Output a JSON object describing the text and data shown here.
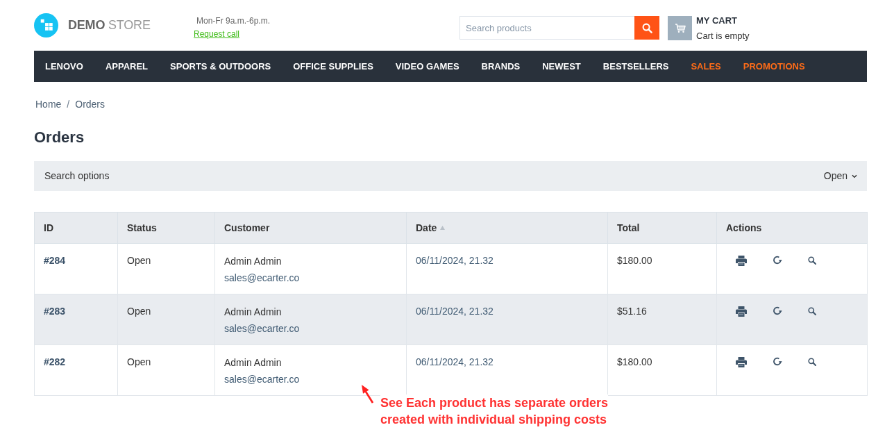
{
  "header": {
    "logo_text": "**DEMO** STORE",
    "hours": "Mon-Fr 9a.m.-6p.m.",
    "request_call": "Request call",
    "search": {
      "placeholder": "Search products"
    },
    "cart": {
      "title": "MY CART",
      "status": "Cart is empty"
    }
  },
  "nav": [
    {
      "label": "LENOVO",
      "highlighted": false
    },
    {
      "label": "APPAREL",
      "highlighted": false
    },
    {
      "label": "SPORTS & OUTDOORS",
      "highlighted": false
    },
    {
      "label": "OFFICE SUPPLIES",
      "highlighted": false
    },
    {
      "label": "VIDEO GAMES",
      "highlighted": false
    },
    {
      "label": "BRANDS",
      "highlighted": false
    },
    {
      "label": "NEWEST",
      "highlighted": false
    },
    {
      "label": "BESTSELLERS",
      "highlighted": false
    },
    {
      "label": "SALES",
      "highlighted": true
    },
    {
      "label": "PROMOTIONS",
      "highlighted": true
    }
  ],
  "breadcrumb": {
    "items": [
      "Home",
      "Orders"
    ],
    "separator": "/"
  },
  "page_title": "Orders",
  "search_options": {
    "label": "Search options",
    "toggle": "Open"
  },
  "table": {
    "columns": [
      {
        "label": "ID",
        "sorted": false
      },
      {
        "label": "Status",
        "sorted": false
      },
      {
        "label": "Customer",
        "sorted": false
      },
      {
        "label": "Date",
        "sorted": true
      },
      {
        "label": "Total",
        "sorted": false
      },
      {
        "label": "Actions",
        "sorted": false
      }
    ],
    "rows": [
      {
        "id": "#284",
        "status": "Open",
        "customer_name": "Admin Admin",
        "customer_email": "sales@ecarter.co",
        "date": "06/11/2024, 21.32",
        "total": "$180.00"
      },
      {
        "id": "#283",
        "status": "Open",
        "customer_name": "Admin Admin",
        "customer_email": "sales@ecarter.co",
        "date": "06/11/2024, 21.32",
        "total": "$51.16"
      },
      {
        "id": "#282",
        "status": "Open",
        "customer_name": "Admin Admin",
        "customer_email": "sales@ecarter.co",
        "date": "06/11/2024, 21.32",
        "total": "$180.00"
      }
    ]
  },
  "annotation": {
    "text": "See Each product has separate orders\ncreated with individual shipping costs"
  }
}
